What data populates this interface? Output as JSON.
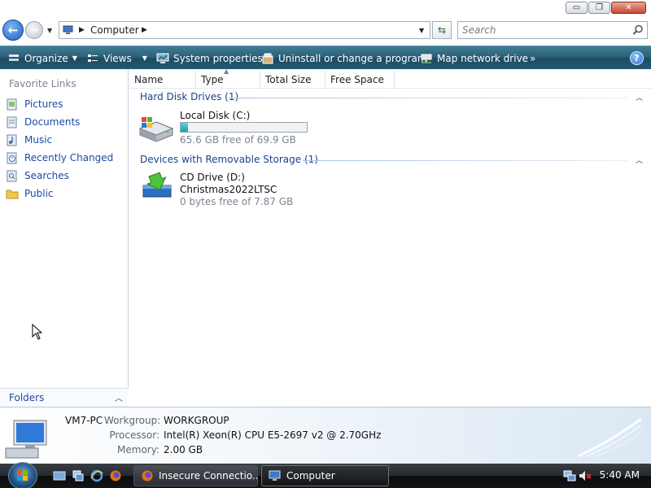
{
  "window": {
    "controls": {
      "minimize": "▭",
      "maximize": "❐",
      "close": "✕"
    }
  },
  "address": {
    "crumbs": [
      "Computer"
    ],
    "search_placeholder": "Search"
  },
  "toolbar": {
    "items": [
      {
        "label": "Organize",
        "icon": "organize-icon",
        "dropdown": true
      },
      {
        "label": "Views",
        "icon": "views-icon",
        "dropdown": true
      },
      {
        "label": "System properties",
        "icon": "system-properties-icon"
      },
      {
        "label": "Uninstall or change a program",
        "icon": "uninstall-icon"
      },
      {
        "label": "Map network drive",
        "icon": "map-network-drive-icon"
      }
    ],
    "overflow": "»",
    "help": "?"
  },
  "sidebar": {
    "title": "Favorite Links",
    "items": [
      {
        "label": "Pictures",
        "icon": "pictures-folder-icon"
      },
      {
        "label": "Documents",
        "icon": "documents-folder-icon"
      },
      {
        "label": "Music",
        "icon": "music-folder-icon"
      },
      {
        "label": "Recently Changed",
        "icon": "recently-changed-icon"
      },
      {
        "label": "Searches",
        "icon": "searches-folder-icon"
      },
      {
        "label": "Public",
        "icon": "public-folder-icon"
      }
    ],
    "folders_label": "Folders"
  },
  "columns": [
    "Name",
    "Type",
    "Total Size",
    "Free Space"
  ],
  "groups": [
    {
      "title": "Hard Disk Drives (1)",
      "drives": [
        {
          "name": "Local Disk (C:)",
          "subtitle": "65.6 GB free of 69.9 GB",
          "used_fraction": 0.061,
          "icon": "hard-disk-icon"
        }
      ]
    },
    {
      "title": "Devices with Removable Storage (1)",
      "drives": [
        {
          "name": "CD Drive (D:)",
          "label": "Christmas2022LTSC",
          "subtitle": "0 bytes free of 7.87 GB",
          "icon": "cd-drive-icon"
        }
      ]
    }
  ],
  "details": {
    "computer_name": "VM7-PC",
    "workgroup_label": "Workgroup:",
    "workgroup": "WORKGROUP",
    "processor_label": "Processor:",
    "processor": "Intel(R) Xeon(R) CPU E5-2697 v2 @ 2.70GHz",
    "memory_label": "Memory:",
    "memory": "2.00 GB"
  },
  "taskbar": {
    "tasks": [
      {
        "label": "Insecure Connectio...",
        "icon": "firefox-icon",
        "active": false
      },
      {
        "label": "Computer",
        "icon": "computer-icon",
        "active": true
      }
    ],
    "clock": "5:40 AM"
  },
  "colors": {
    "toolbar": "#2b5f78",
    "link": "#1c4aa7",
    "group_header": "#1e3f8f",
    "progress": "#1b9fb2"
  }
}
